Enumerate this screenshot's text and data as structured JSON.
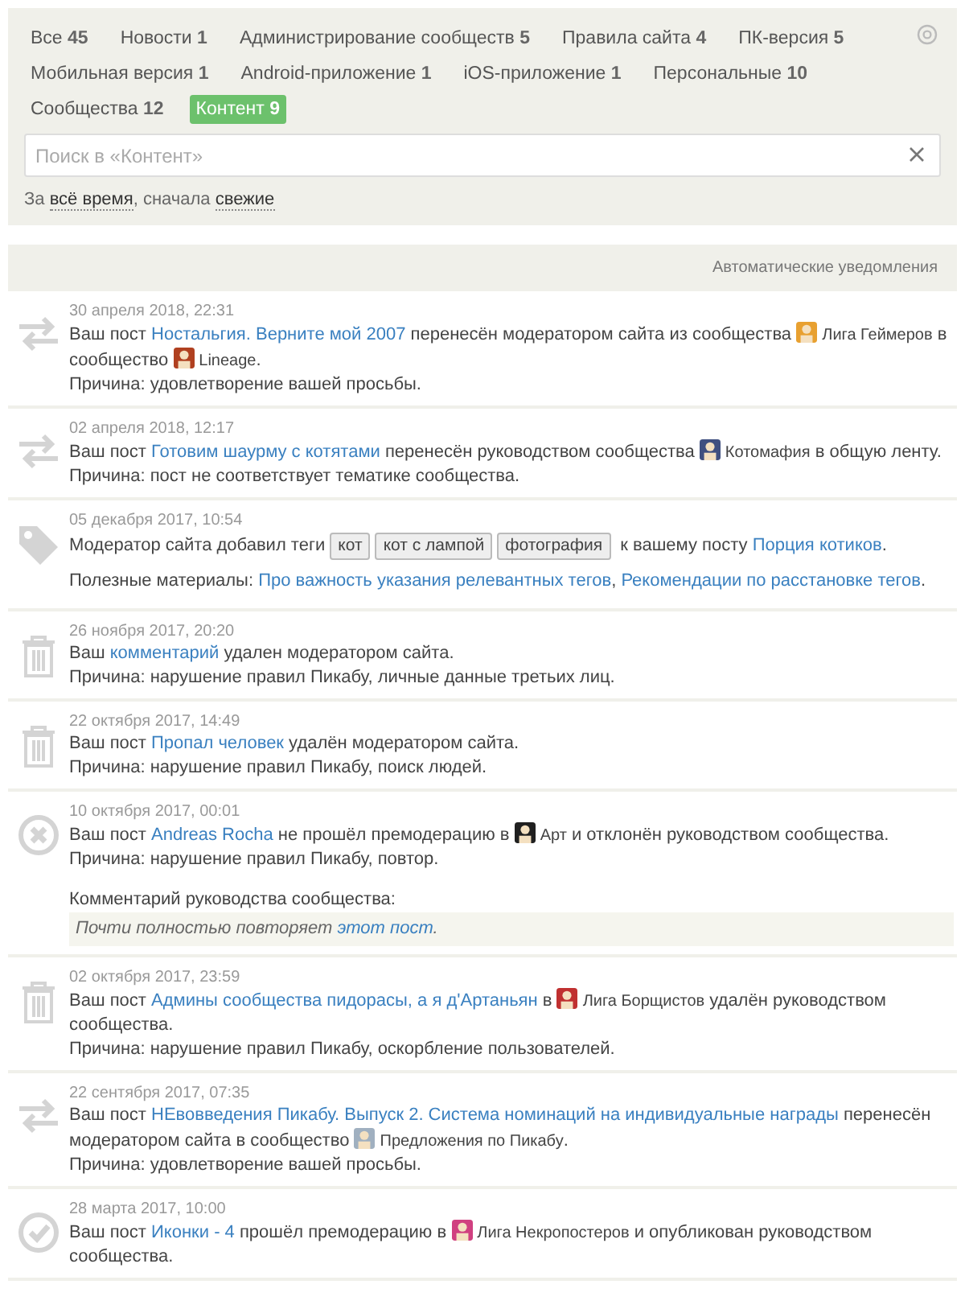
{
  "filters": [
    {
      "label": "Все",
      "count": "45",
      "selected": false
    },
    {
      "label": "Новости",
      "count": "1",
      "selected": false
    },
    {
      "label": "Администрирование сообществ",
      "count": "5",
      "selected": false
    },
    {
      "label": "Правила сайта",
      "count": "4",
      "selected": false
    },
    {
      "label": "ПК-версия",
      "count": "5",
      "selected": false
    },
    {
      "label": "Мобильная версия",
      "count": "1",
      "selected": false
    },
    {
      "label": "Android-приложение",
      "count": "1",
      "selected": false
    },
    {
      "label": "iOS-приложение",
      "count": "1",
      "selected": false
    },
    {
      "label": "Персональные",
      "count": "10",
      "selected": false
    },
    {
      "label": "Сообщества",
      "count": "12",
      "selected": false
    },
    {
      "label": "Контент",
      "count": "9",
      "selected": true
    }
  ],
  "search": {
    "placeholder": "Поиск в «Контент»"
  },
  "sort": [
    {
      "kind": "text",
      "text": "За "
    },
    {
      "kind": "option",
      "text": "всё время"
    },
    {
      "kind": "text",
      "text": ", сначала "
    },
    {
      "kind": "option",
      "text": "свежие"
    }
  ],
  "section_title": "Автоматические уведомления",
  "notifications": [
    {
      "kind": "move",
      "date": "30 апреля 2018, 22:31",
      "message": [
        {
          "kind": "text",
          "text": "Ваш пост "
        },
        {
          "kind": "link",
          "text": "Ностальгия. Верните мой 2007"
        },
        {
          "kind": "text",
          "text": " перенесён модератором сайта из сообщества "
        },
        {
          "kind": "community",
          "text": "Лига Геймеров",
          "color": "#e8a030"
        },
        {
          "kind": "text",
          "text": " в сообщество "
        },
        {
          "kind": "community",
          "text": "Lineage",
          "color": "#b04020"
        },
        {
          "kind": "text",
          "text": "."
        }
      ],
      "reason": "Причина: удовлетворение вашей просьбы."
    },
    {
      "kind": "move",
      "date": "02 апреля 2018, 12:17",
      "message": [
        {
          "kind": "text",
          "text": "Ваш пост "
        },
        {
          "kind": "link",
          "text": "Готовим шаурму с котятами"
        },
        {
          "kind": "text",
          "text": " перенесён руководством сообщества "
        },
        {
          "kind": "community",
          "text": "Котомафия",
          "color": "#405080"
        },
        {
          "kind": "text",
          "text": " в общую ленту."
        }
      ],
      "reason": "Причина: пост не соответствует тематике сообщества."
    },
    {
      "kind": "tag",
      "date": "05 декабря 2017, 10:54",
      "message": [
        {
          "kind": "text",
          "text": "Модератор сайта добавил теги "
        },
        {
          "kind": "tag",
          "text": "кот"
        },
        {
          "kind": "tag",
          "text": "кот с лампой"
        },
        {
          "kind": "tag",
          "text": "фотография"
        },
        {
          "kind": "text",
          "text": " к вашему посту "
        },
        {
          "kind": "link",
          "text": "Порция котиков"
        },
        {
          "kind": "text",
          "text": "."
        }
      ],
      "materials": [
        {
          "kind": "text",
          "text": "Полезные материалы: "
        },
        {
          "kind": "link",
          "text": "Про важность указания релевантных тегов"
        },
        {
          "kind": "text",
          "text": ", "
        },
        {
          "kind": "link",
          "text": "Рекомендации по расстановке тегов"
        },
        {
          "kind": "text",
          "text": "."
        }
      ]
    },
    {
      "kind": "delete",
      "date": "26 ноября 2017, 20:20",
      "message": [
        {
          "kind": "text",
          "text": "Ваш "
        },
        {
          "kind": "link",
          "text": "комментарий"
        },
        {
          "kind": "text",
          "text": " удален модератором сайта."
        }
      ],
      "reason": "Причина: нарушение правил Пикабу, личные данные третьих лиц."
    },
    {
      "kind": "delete",
      "date": "22 октября 2017, 14:49",
      "message": [
        {
          "kind": "text",
          "text": "Ваш пост "
        },
        {
          "kind": "link",
          "text": "Пропал человек"
        },
        {
          "kind": "text",
          "text": " удалён модератором сайта."
        }
      ],
      "reason": "Причина: нарушение правил Пикабу, поиск людей."
    },
    {
      "kind": "reject",
      "date": "10 октября 2017, 00:01",
      "message": [
        {
          "kind": "text",
          "text": "Ваш пост "
        },
        {
          "kind": "link",
          "text": "Andreas Rocha"
        },
        {
          "kind": "text",
          "text": " не прошёл премодерацию в "
        },
        {
          "kind": "community",
          "text": "Арт",
          "color": "#202020"
        },
        {
          "kind": "text",
          "text": " и отклонён руководством сообщества."
        }
      ],
      "reason": "Причина: нарушение правил Пикабу, повтор.",
      "comment_title": "Комментарий руководства сообщества:",
      "comment": [
        {
          "kind": "text",
          "text": "Почти полностью повторяет "
        },
        {
          "kind": "link",
          "text": "этот пост"
        },
        {
          "kind": "text",
          "text": "."
        }
      ]
    },
    {
      "kind": "delete",
      "date": "02 октября 2017, 23:59",
      "message": [
        {
          "kind": "text",
          "text": "Ваш пост "
        },
        {
          "kind": "link",
          "text": "Админы сообщества пидорасы, а я д'Артаньян"
        },
        {
          "kind": "text",
          "text": " в "
        },
        {
          "kind": "community",
          "text": "Лига Борщистов",
          "color": "#c03030"
        },
        {
          "kind": "text",
          "text": " удалён руководством сообщества."
        }
      ],
      "reason": "Причина: нарушение правил Пикабу, оскорбление пользователей."
    },
    {
      "kind": "move",
      "date": "22 сентября 2017, 07:35",
      "message": [
        {
          "kind": "text",
          "text": "Ваш пост "
        },
        {
          "kind": "link",
          "text": "НЕвовведения Пикабу. Выпуск 2. Система номинаций на индивидуальные награды"
        },
        {
          "kind": "text",
          "text": " перенесён модератором сайта в сообщество "
        },
        {
          "kind": "community",
          "text": "Предложения по Пикабу",
          "color": "#a0b0c0"
        },
        {
          "kind": "text",
          "text": "."
        }
      ],
      "reason": "Причина: удовлетворение вашей просьбы."
    },
    {
      "kind": "approve",
      "date": "28 марта 2017, 10:00",
      "message": [
        {
          "kind": "text",
          "text": "Ваш пост "
        },
        {
          "kind": "link",
          "text": "Иконки - 4"
        },
        {
          "kind": "text",
          "text": " прошёл премодерацию в "
        },
        {
          "kind": "community",
          "text": "Лига Некропостеров",
          "color": "#d04080"
        },
        {
          "kind": "text",
          "text": " и опубликован руководством сообщества."
        }
      ]
    }
  ]
}
